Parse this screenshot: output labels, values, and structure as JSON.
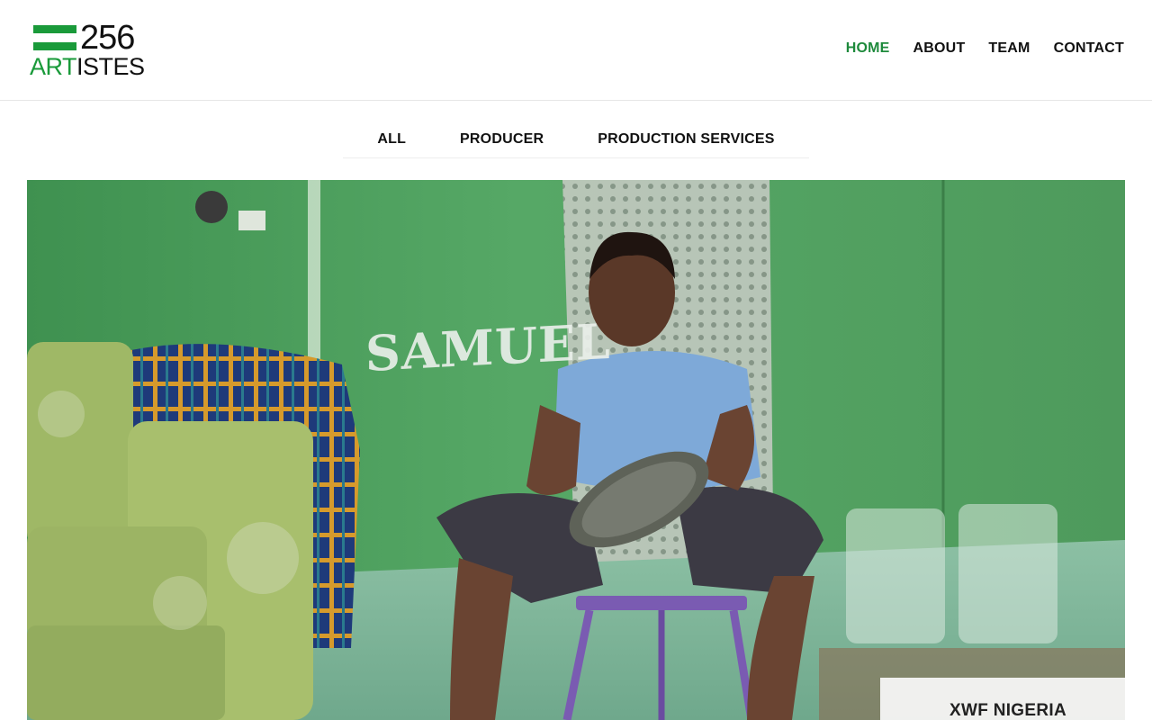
{
  "brand": {
    "number": "256",
    "word_accent": "ART",
    "word_rest": "ISTES",
    "colors": {
      "green": "#1a9a3a",
      "nav_active": "#1e8a3c"
    }
  },
  "nav": {
    "items": [
      {
        "label": "HOME",
        "active": true
      },
      {
        "label": "ABOUT",
        "active": false
      },
      {
        "label": "TEAM",
        "active": false
      },
      {
        "label": "CONTACT",
        "active": false
      }
    ]
  },
  "filters": {
    "tabs": [
      {
        "label": "ALL"
      },
      {
        "label": "PRODUCER"
      },
      {
        "label": "PRODUCTION SERVICES"
      }
    ]
  },
  "hero": {
    "title_overlay": "SAMUEL",
    "caption": "XWF NIGERIA"
  }
}
